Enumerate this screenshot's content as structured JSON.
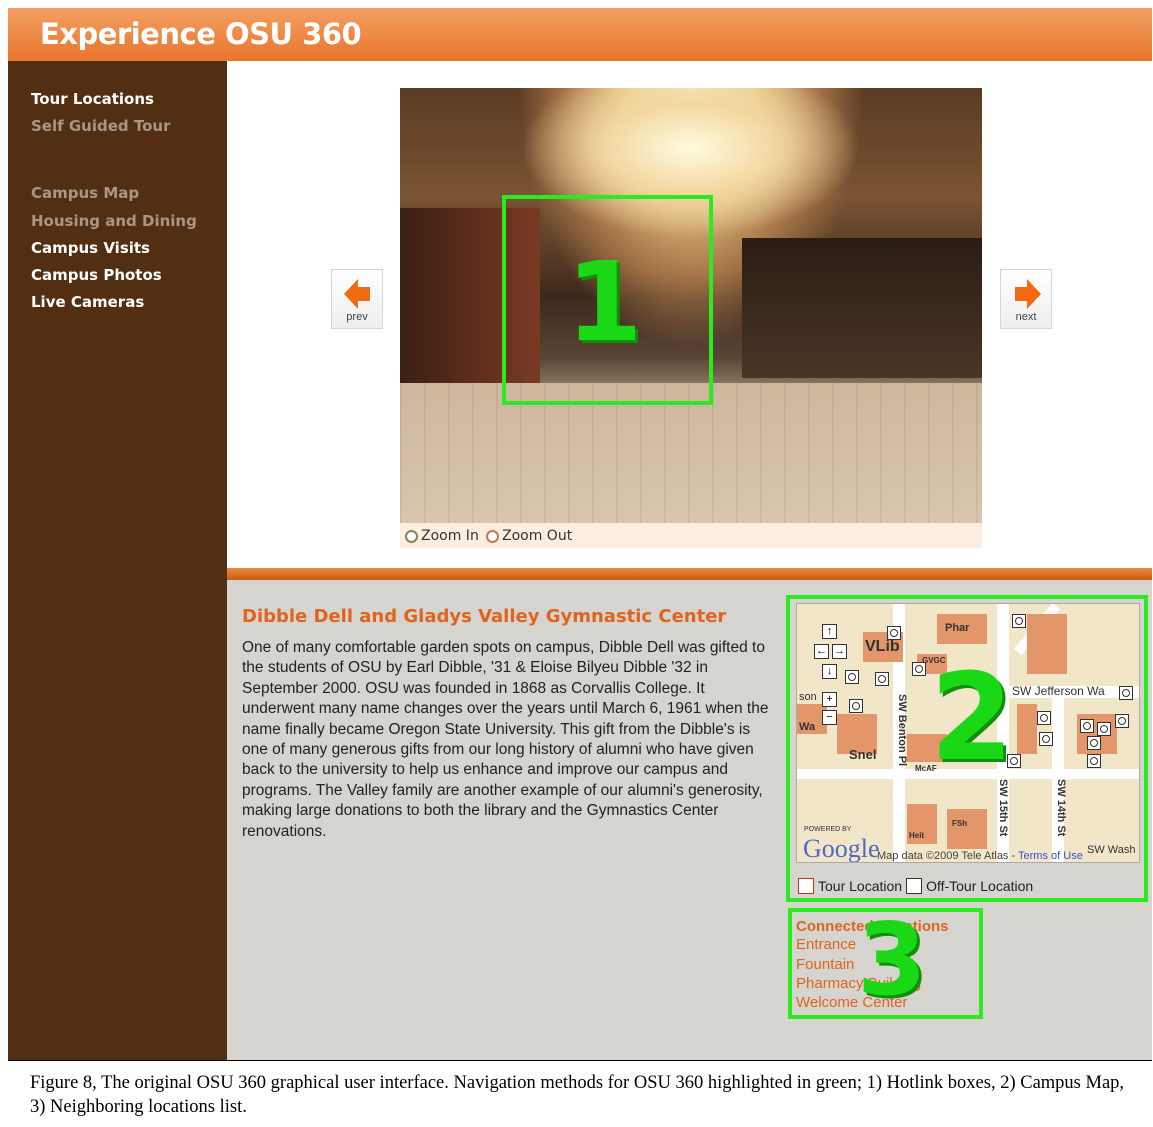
{
  "header": {
    "title": "Experience OSU 360"
  },
  "sidebar": {
    "items": [
      {
        "label": "Tour Locations"
      },
      {
        "label": "Self Guided Tour"
      },
      {
        "label": "Campus Map"
      },
      {
        "label": "Housing and Dining"
      },
      {
        "label": "Campus Visits"
      },
      {
        "label": "Campus Photos"
      },
      {
        "label": "Live Cameras"
      }
    ]
  },
  "viewer": {
    "prev_label": "prev",
    "next_label": "next",
    "zoom_in": "Zoom In",
    "zoom_out": "Zoom Out",
    "arrow_color": "#f26a13"
  },
  "highlights": {
    "one": "1",
    "two": "2",
    "three": "3",
    "color": "#2bea22"
  },
  "location": {
    "title": "Dibble Dell and Gladys Valley Gymnastic Center",
    "description": "One of many comfortable garden spots on campus, Dibble Dell was gifted to the students of OSU by Earl Dibble, '31 & Eloise Bilyeu Dibble '32 in September 2000. OSU was founded in 1868 as Corvallis College. It underwent many name changes over the years until March 6, 1961 when the name finally became Oregon State University. This gift from the Dibble's is one of many generous gifts from our long history of alumni who have given back to the university to help us enhance and improve our campus and programs. The Valley family are another example of our alumni's generosity, making large donations to both the library and the Gymnastics Center renovations."
  },
  "map": {
    "labels": {
      "vlib": "VLib",
      "phar": "Phar",
      "gvgc": "GVGC",
      "snel": "Snel",
      "mcaf": "McAF",
      "fsh": "FSh",
      "heit": "Heit",
      "wa": "Wa",
      "son": "son",
      "jefferson": "SW Jefferson Wa",
      "benton": "SW Benton Pl",
      "fifteenth": "SW 15th St",
      "fourteenth": "SW 14th St",
      "wash": "SW Wash"
    },
    "powered_by": "POWERED BY",
    "google": "Google",
    "map_data": "Map data ©2009 Tele Atlas - ",
    "terms": "Terms of Use"
  },
  "legend": {
    "tour": "Tour Location",
    "off_tour": "Off-Tour Location"
  },
  "connected": {
    "title": "Connected Locations",
    "items": [
      "Entrance",
      "Fountain",
      "Pharmacy Building",
      "Welcome Center"
    ]
  },
  "caption": "Figure 8, The original OSU 360 graphical user interface.  Navigation methods for OSU 360 highlighted in green; 1) Hotlink boxes, 2) Campus Map, 3) Neighboring locations list."
}
